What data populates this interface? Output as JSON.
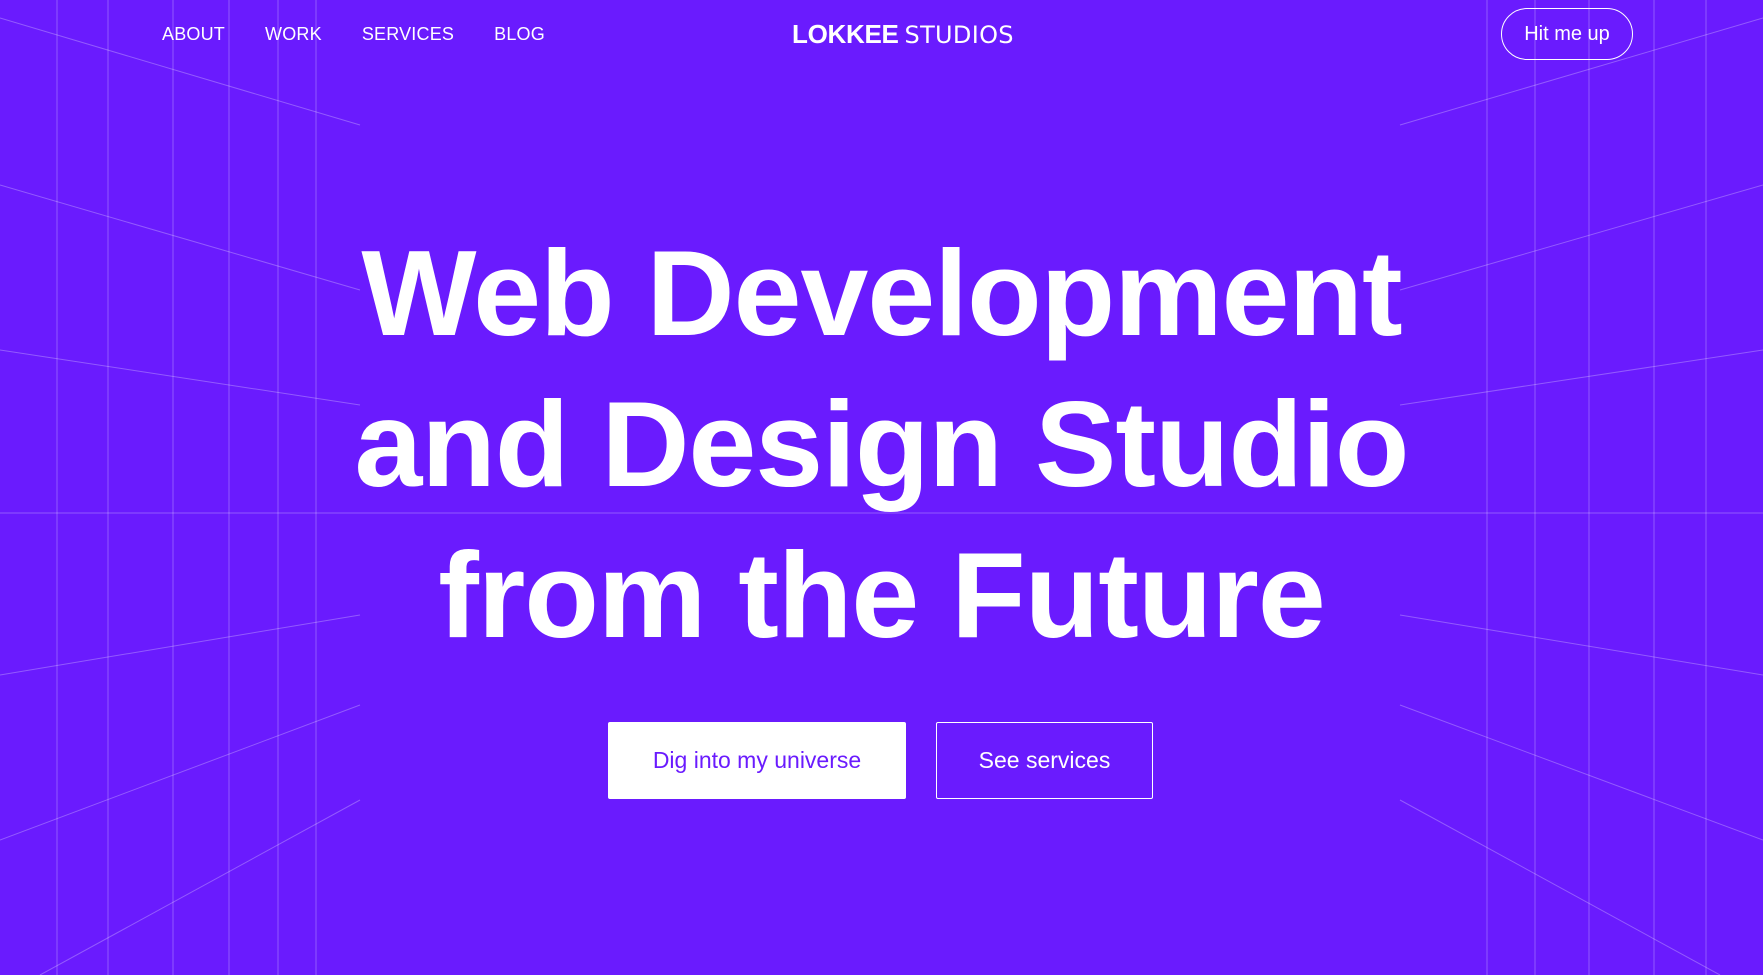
{
  "nav": {
    "links": [
      {
        "label": "ABOUT"
      },
      {
        "label": "WORK"
      },
      {
        "label": "SERVICES"
      },
      {
        "label": "BLOG"
      }
    ]
  },
  "brand": {
    "bold": "LOKKEE",
    "light": "STUDIOS"
  },
  "header": {
    "contact_label": "Hit me up"
  },
  "hero": {
    "lines": [
      "Web Development",
      "and Design Studio",
      "from the Future"
    ],
    "primary_cta": "Dig into my universe",
    "secondary_cta": "See services"
  },
  "colors": {
    "background": "#6a1bfe",
    "foreground": "#ffffff",
    "accent": "#6a1bfe"
  }
}
